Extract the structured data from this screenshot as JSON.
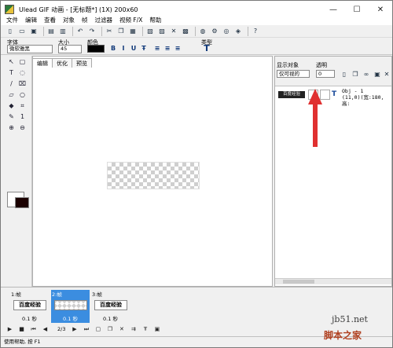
{
  "titlebar": {
    "title": "Ulead GIF 动画 - [无标题*] (1X) 200x60",
    "minimize": "—",
    "maximize": "☐",
    "close": "✕"
  },
  "menu": [
    "文件",
    "编辑",
    "查看",
    "对象",
    "帧",
    "过滤器",
    "视频 F/X",
    "帮助"
  ],
  "fontbar": {
    "font_label": "字体",
    "font_value": "微软雅黑",
    "size_label": "大小",
    "size_value": "45",
    "color_label": "颜色",
    "color_value": "#000000",
    "type_label": "类型",
    "bold": "B",
    "italic": "I",
    "underline": "U",
    "strike": "Ŧ"
  },
  "editor": {
    "tabs": [
      "编辑",
      "优化",
      "预览"
    ],
    "active_tab": "编辑"
  },
  "objects": {
    "show_label": "显示对象",
    "show_value": "仅可视的",
    "opacity_label": "透明",
    "opacity_value": "0",
    "item_name": "百度经验",
    "item_info_line1": "Obj - 1",
    "item_info_line2": "(11,0)(宽:180,高:"
  },
  "frames": [
    {
      "label": "1:帧",
      "content": "百度经验",
      "duration": "0.1 秒",
      "selected": false
    },
    {
      "label": "2:帧",
      "content": "",
      "duration": "0.1 秒",
      "selected": true
    },
    {
      "label": "3:帧",
      "content": "百度经验",
      "duration": "0.1 秒",
      "selected": false
    }
  ],
  "playback": {
    "counter": "2/3"
  },
  "status": {
    "text": "使用帮助, 按 F1"
  },
  "watermark": {
    "line1": "jb51.net",
    "line2": "脚本之家"
  },
  "colors": {
    "selection": "#3b8de0",
    "arrow": "#e03030"
  }
}
